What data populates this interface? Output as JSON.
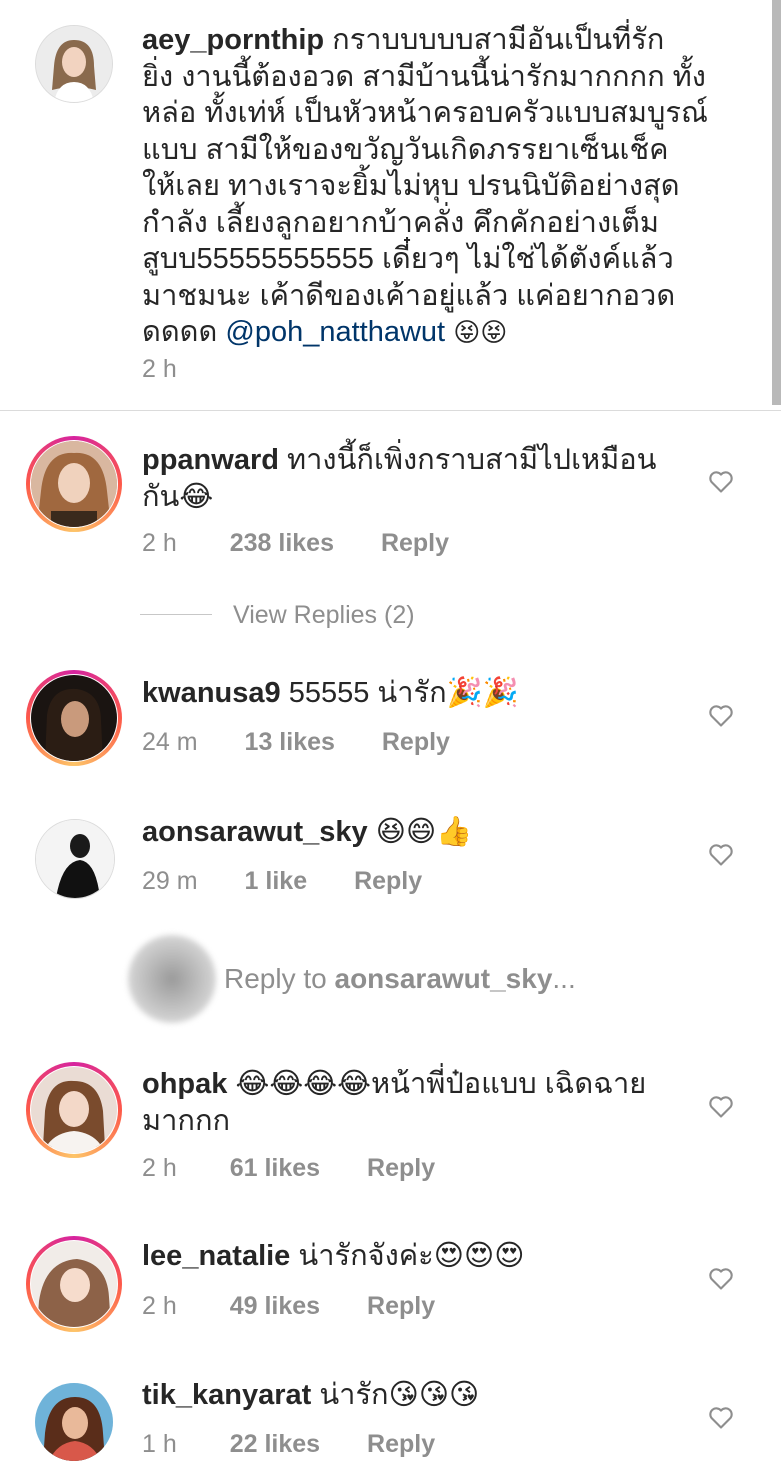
{
  "caption": {
    "username": "aey_pornthip",
    "lines": [
      "กราบบบบบสามีอันเป็นที่รัก",
      "ยิ่ง งานนี้ต้องอวด สามีบ้านนี้น่ารักมากกกก ทั้ง",
      "หล่อ ทั้งเท่ห์ เป็นหัวหน้าครอบครัวแบบสมบูรณ์",
      "แบบ สามีให้ของขวัญวันเกิดภรรยาเซ็นเช็ค",
      "ให้เลย ทางเราจะยิ้มไม่หุบ ปรนนิบัติอย่างสุด",
      "กำลัง เลี้ยงลูกอยากบ้าคลั่ง คึกคักอย่างเต็ม",
      "สูบบ55555555555 เดี๋ยวๆ ไม่ใช่ได้ตังค์แล้ว",
      "มาชมนะ เค้าดีของเค้าอยู่แล้ว แค่อยากอวด",
      "ดดดด"
    ],
    "mention": "@poh_natthawut",
    "emojis": "😝😝",
    "time": "2 h"
  },
  "comments": [
    {
      "username": "ppanward",
      "line1": "ทางนี้ก็เพิ่งกราบสามีไปเหมือน",
      "line2": "กัน😂",
      "time": "2 h",
      "likes": "238 likes",
      "reply": "Reply"
    },
    {
      "username": "kwanusa9",
      "line1": "55555 น่ารัก🎉🎉",
      "time": "24 m",
      "likes": "13 likes",
      "reply": "Reply"
    },
    {
      "username": "aonsarawut_sky",
      "line1": "😆😄👍",
      "time": "29 m",
      "likes": "1 like",
      "reply": "Reply"
    },
    {
      "username": "ohpak",
      "line1": "😂😂😂😂หน้าพี่ป๋อแบบ เฉิดฉาย",
      "line2": "มากกก",
      "time": "2 h",
      "likes": "61 likes",
      "reply": "Reply"
    },
    {
      "username": "lee_natalie",
      "line1": "น่ารักจังค่ะ😍😍😍",
      "time": "2 h",
      "likes": "49 likes",
      "reply": "Reply"
    },
    {
      "username": "tik_kanyarat",
      "line1": "น่ารัก😘😘😘",
      "time": "1 h",
      "likes": "22 likes",
      "reply": "Reply"
    }
  ],
  "view_replies": "View Replies (2)",
  "reply_prompt": {
    "prefix": "Reply to ",
    "username": "aonsarawut_sky",
    "suffix": "..."
  },
  "icons": {
    "heart": "heart-outline-icon"
  },
  "colors": {
    "text": "#262626",
    "muted": "#8e8e8e",
    "mention": "#003569",
    "divider": "#dbdbdb"
  }
}
